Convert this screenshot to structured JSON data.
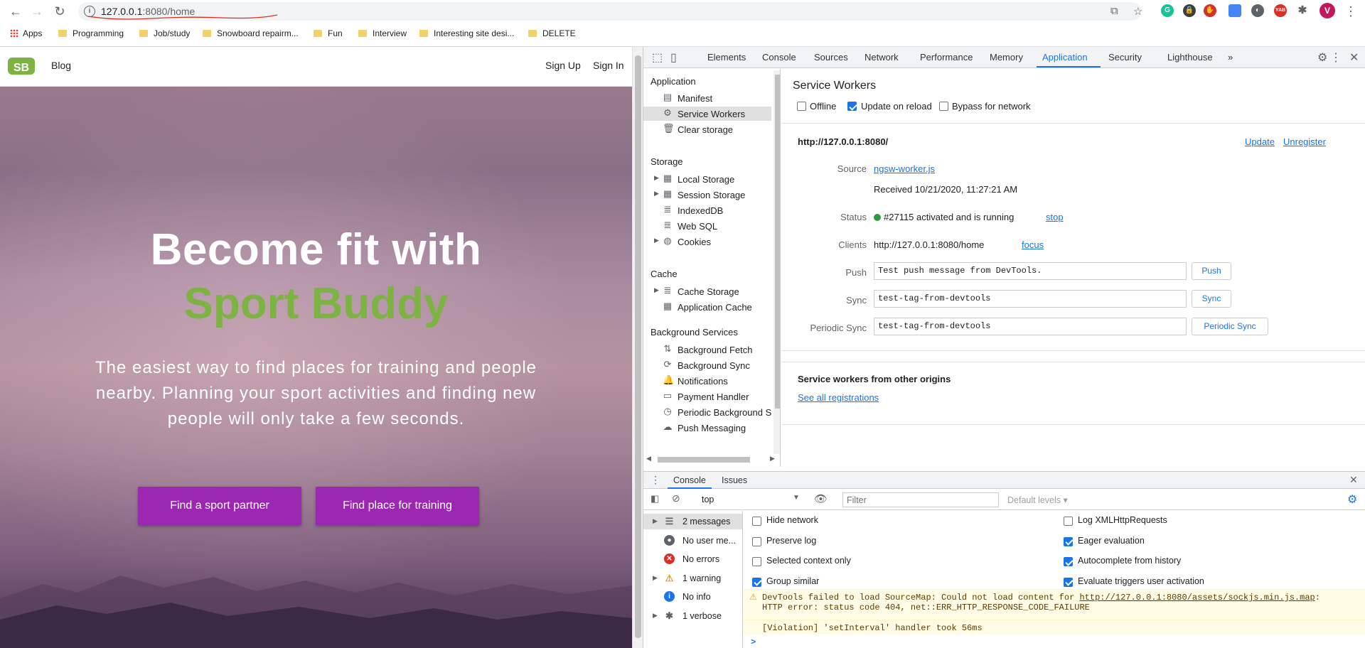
{
  "browser": {
    "url_host": "127.0.0.1",
    "url_rest": ":8080/home",
    "bookmarks": [
      {
        "label": "Apps",
        "type": "apps"
      },
      {
        "label": "Programming",
        "type": "folder"
      },
      {
        "label": "Job/study",
        "type": "folder"
      },
      {
        "label": "Snowboard repairm...",
        "type": "folder"
      },
      {
        "label": "Fun",
        "type": "folder"
      },
      {
        "label": "Interview",
        "type": "folder"
      },
      {
        "label": "Interesting site desi...",
        "type": "folder"
      },
      {
        "label": "DELETE",
        "type": "folder"
      }
    ],
    "profile_initial": "V",
    "ext_badge": "YAB"
  },
  "site": {
    "logo": "SB",
    "nav_blog": "Blog",
    "sign_up": "Sign Up",
    "sign_in": "Sign In",
    "title_line1": "Become fit with",
    "title_line2": "Sport Buddy",
    "subtitle": "The easiest way to find places for training and people nearby. Planning your sport activities and finding new people will only take a few seconds.",
    "btn_partner": "Find a sport partner",
    "btn_place": "Find place for training",
    "accent_green": "#7cb342",
    "accent_purple": "#9c27b0"
  },
  "devtools": {
    "tabs": [
      "Elements",
      "Console",
      "Sources",
      "Network",
      "Performance",
      "Memory",
      "Application",
      "Security",
      "Lighthouse"
    ],
    "active_tab": "Application",
    "more_tabs": "»",
    "sidebar": {
      "application_heading": "Application",
      "application_items": [
        {
          "label": "Manifest",
          "icon": "document-icon"
        },
        {
          "label": "Service Workers",
          "icon": "gear-icon",
          "selected": true
        },
        {
          "label": "Clear storage",
          "icon": "trash-icon"
        }
      ],
      "storage_heading": "Storage",
      "storage_items": [
        {
          "label": "Local Storage",
          "icon": "grid-icon",
          "expandable": true
        },
        {
          "label": "Session Storage",
          "icon": "grid-icon",
          "expandable": true
        },
        {
          "label": "IndexedDB",
          "icon": "database-icon"
        },
        {
          "label": "Web SQL",
          "icon": "database-icon"
        },
        {
          "label": "Cookies",
          "icon": "cookie-icon",
          "expandable": true
        }
      ],
      "cache_heading": "Cache",
      "cache_items": [
        {
          "label": "Cache Storage",
          "icon": "database-icon",
          "expandable": true
        },
        {
          "label": "Application Cache",
          "icon": "grid-icon"
        }
      ],
      "bg_heading": "Background Services",
      "bg_items": [
        {
          "label": "Background Fetch",
          "icon": "updown-arrows-icon"
        },
        {
          "label": "Background Sync",
          "icon": "sync-icon"
        },
        {
          "label": "Notifications",
          "icon": "bell-icon"
        },
        {
          "label": "Payment Handler",
          "icon": "card-icon"
        },
        {
          "label": "Periodic Background Sync",
          "icon": "clock-icon"
        },
        {
          "label": "Push Messaging",
          "icon": "cloud-icon"
        }
      ]
    },
    "sw": {
      "title": "Service Workers",
      "offline": "Offline",
      "update_on_reload": "Update on reload",
      "bypass": "Bypass for network",
      "origin": "http://127.0.0.1:8080/",
      "update": "Update",
      "unregister": "Unregister",
      "source_label": "Source",
      "source_link": "ngsw-worker.js",
      "received": "Received 10/21/2020, 11:27:21 AM",
      "status_label": "Status",
      "status_text": "#27115 activated and is running",
      "stop": "stop",
      "clients_label": "Clients",
      "clients_url": "http://127.0.0.1:8080/home",
      "focus": "focus",
      "push_label": "Push",
      "push_value": "Test push message from DevTools.",
      "push_btn": "Push",
      "sync_label": "Sync",
      "sync_value": "test-tag-from-devtools",
      "sync_btn": "Sync",
      "psync_label": "Periodic Sync",
      "psync_value": "test-tag-from-devtools",
      "psync_btn": "Periodic Sync",
      "other_heading": "Service workers from other origins",
      "see_all": "See all registrations"
    },
    "drawer": {
      "tab_console": "Console",
      "tab_issues": "Issues",
      "context": "top",
      "filter_placeholder": "Filter",
      "levels": "Default levels",
      "sidebar": [
        {
          "label": "2 messages",
          "icon": "list-icon",
          "expandable": true,
          "selected": true
        },
        {
          "label": "No user me...",
          "icon": "user-icon"
        },
        {
          "label": "No errors",
          "icon": "error-icon"
        },
        {
          "label": "1 warning",
          "icon": "warning-icon",
          "expandable": true
        },
        {
          "label": "No info",
          "icon": "info-icon"
        },
        {
          "label": "1 verbose",
          "icon": "bug-icon",
          "expandable": true
        }
      ],
      "settings_left": [
        {
          "label": "Hide network",
          "checked": false
        },
        {
          "label": "Preserve log",
          "checked": false
        },
        {
          "label": "Selected context only",
          "checked": false
        },
        {
          "label": "Group similar",
          "checked": true
        }
      ],
      "settings_right": [
        {
          "label": "Log XMLHttpRequests",
          "checked": false
        },
        {
          "label": "Eager evaluation",
          "checked": true
        },
        {
          "label": "Autocomplete from history",
          "checked": true
        },
        {
          "label": "Evaluate triggers user activation",
          "checked": true
        }
      ],
      "warn_prefix": "DevTools failed to load SourceMap: Could not load content for ",
      "warn_link": "http://127.0.0.1:8080/assets/sockjs.min.js.map",
      "warn_suffix": ":",
      "warn_line2": "HTTP error: status code 404, net::ERR_HTTP_RESPONSE_CODE_FAILURE",
      "violation": "[Violation] 'setInterval' handler took 56ms",
      "prompt": ">"
    }
  }
}
